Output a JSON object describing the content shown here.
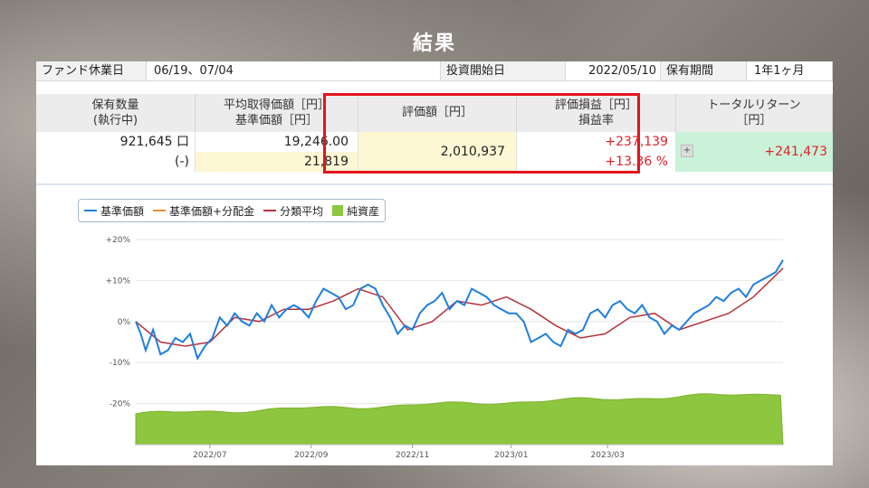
{
  "page_title": "結果",
  "info_bar": {
    "fund_holiday_label": "ファンド休業日",
    "fund_holiday_value": "06/19、07/04",
    "start_label": "投資開始日",
    "start_value": "2022/05/10",
    "period_label": "保有期間",
    "period_value": "1年1ヶ月"
  },
  "table": {
    "headers": {
      "quantity": [
        "保有数量",
        "(執行中)"
      ],
      "avg_price": [
        "平均取得価額［円］",
        "基準価額［円］"
      ],
      "valuation": "評価額［円］",
      "gain": [
        "評価損益［円］",
        "損益率"
      ],
      "total_return": [
        "トータルリターン",
        "［円］"
      ]
    },
    "values": {
      "quantity": "921,645 口",
      "pending": "(-)",
      "avg_price": "19,246.00",
      "nav": "21,819",
      "valuation": "2,010,937",
      "gain": "+237,139",
      "gain_rate": "+13.36 %",
      "expand_icon": "+",
      "total_return": "+241,473"
    }
  },
  "legend": {
    "nav": "基準価額",
    "nav_dist": "基準価額+分配金",
    "category_avg": "分類平均",
    "net_assets": "純資産"
  },
  "colors": {
    "nav": "#1f7fe0",
    "nav_dist": "#f08c2a",
    "category_avg": "#b7313a",
    "net_assets": "#8dc63f",
    "highlight": "#e3141c"
  },
  "chart_data": {
    "type": "line",
    "x_ticks": [
      "2022/07",
      "2022/09",
      "2022/11",
      "2023/01",
      "2023/03"
    ],
    "y_ticks": [
      "+20%",
      "+10%",
      "0%",
      "-10%",
      "-20%"
    ],
    "ylim": [
      -30,
      20
    ],
    "x_range_months": [
      0,
      13.1
    ],
    "series": [
      {
        "name": "基準価額",
        "months": [
          0,
          0.1,
          0.2,
          0.35,
          0.5,
          0.65,
          0.8,
          0.95,
          1.1,
          1.25,
          1.4,
          1.55,
          1.7,
          1.85,
          2.0,
          2.15,
          2.3,
          2.45,
          2.6,
          2.75,
          2.9,
          3.05,
          3.2,
          3.35,
          3.5,
          3.65,
          3.8,
          3.95,
          4.1,
          4.25,
          4.4,
          4.55,
          4.7,
          4.85,
          5.0,
          5.15,
          5.3,
          5.45,
          5.6,
          5.75,
          5.9,
          6.05,
          6.2,
          6.35,
          6.5,
          6.65,
          6.8,
          6.95,
          7.1,
          7.25,
          7.4,
          7.55,
          7.7,
          7.85,
          8.0,
          8.15,
          8.3,
          8.45,
          8.6,
          8.75,
          8.9,
          9.05,
          9.2,
          9.35,
          9.5,
          9.65,
          9.8,
          9.95,
          10.1,
          10.25,
          10.4,
          10.55,
          10.7,
          10.85,
          11.0,
          11.15,
          11.3,
          11.45,
          11.6,
          11.75,
          11.9,
          12.05,
          12.2,
          12.35,
          12.5,
          12.65,
          12.8,
          12.95,
          13.1
        ],
        "values": [
          0,
          -3,
          -7,
          -2,
          -8,
          -7,
          -4,
          -5,
          -3,
          -9,
          -6,
          -4,
          1,
          -1,
          2,
          0,
          -1,
          2,
          0,
          4,
          1,
          3,
          4,
          3,
          1,
          5,
          8,
          7,
          6,
          3,
          4,
          8,
          9,
          8,
          4,
          1,
          -3,
          -1,
          -2,
          2,
          4,
          5,
          7,
          3,
          5,
          4,
          8,
          7,
          6,
          4,
          3,
          2,
          2,
          0,
          -5,
          -4,
          -3,
          -5,
          -6,
          -2,
          -3,
          -2,
          2,
          3,
          1,
          4,
          5,
          3,
          2,
          4,
          1,
          0,
          -3,
          -1,
          -2,
          0,
          2,
          3,
          4,
          6,
          5,
          7,
          8,
          6,
          9,
          10,
          11,
          12,
          15
        ]
      },
      {
        "name": "基準価額+分配金",
        "months": [
          0,
          13.1
        ],
        "values": [
          0,
          15
        ]
      },
      {
        "name": "分類平均",
        "months": [
          0,
          0.5,
          1,
          1.5,
          2,
          2.5,
          3,
          3.5,
          4,
          4.5,
          5,
          5.5,
          6,
          6.5,
          7,
          7.5,
          8,
          8.5,
          9,
          9.5,
          10,
          10.5,
          11,
          11.5,
          12,
          12.5,
          13.1
        ],
        "values": [
          0,
          -5,
          -6,
          -5,
          1,
          0,
          3,
          3,
          5,
          8,
          6,
          -2,
          0,
          5,
          4,
          6,
          3,
          -1,
          -4,
          -3,
          1,
          2,
          -2,
          0,
          2,
          6,
          13
        ]
      },
      {
        "name": "純資産",
        "months": [
          0,
          13.1
        ],
        "values": [
          -22.5,
          -17.5
        ]
      }
    ]
  }
}
